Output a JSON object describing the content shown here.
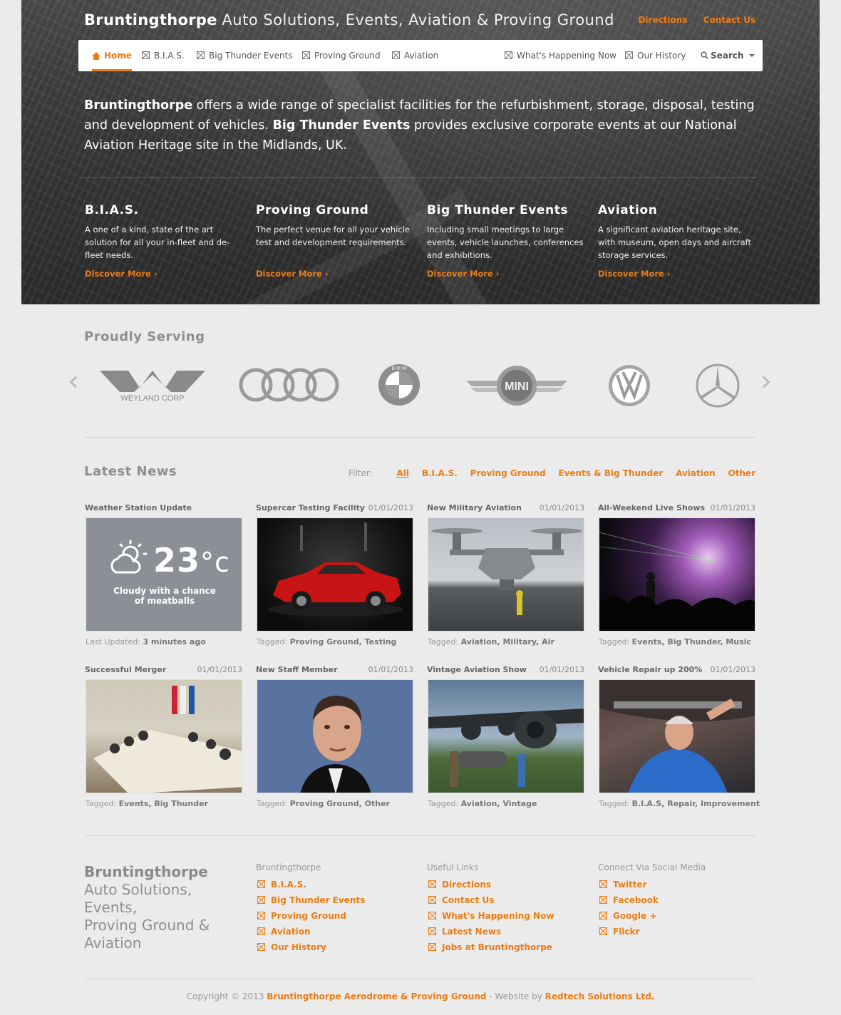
{
  "header": {
    "brand_bold": "Bruntingthorpe",
    "brand_rest": "Auto Solutions, Events, Aviation & Proving Ground",
    "directions": "Directions",
    "contact": "Contact Us"
  },
  "nav": {
    "home": "Home",
    "bias": "B.I.A.S.",
    "big_thunder": "Big Thunder Events",
    "proving": "Proving Ground",
    "aviation": "Aviation",
    "whats_happening": "What's Happening Now",
    "history": "Our History",
    "search": "Search"
  },
  "intro": {
    "b1": "Bruntingthorpe",
    "t1": " offers a wide range of specialist facilities for the refurbishment, storage, disposal, testing and development of vehicles. ",
    "b2": "Big Thunder Events",
    "t2": " provides exclusive corporate events at our National Aviation Heritage site in the Midlands, UK."
  },
  "features": [
    {
      "title": "B.I.A.S.",
      "text": "A one of a kind, state of the art solution for all your in-fleet and de-fleet needs.",
      "link": "Discover More"
    },
    {
      "title": "Proving Ground",
      "text": "The perfect venue for all your vehicle test and development requirements.",
      "link": "Discover More"
    },
    {
      "title": "Big Thunder Events",
      "text": "Including small meetings to large events, vehicle launches, conferences and exhibitions.",
      "link": "Discover More"
    },
    {
      "title": "Aviation",
      "text": "A significant aviation heritage site, with museum, open days and aircraft storage services.",
      "link": "Discover More"
    }
  ],
  "serving": {
    "title": "Proudly Serving",
    "weyland": "WEYLAND CORP",
    "mini": "MINI",
    "bmw": "B M W"
  },
  "news": {
    "title": "Latest News",
    "filter_label": "Filter:",
    "filters": [
      "All",
      "B.I.A.S.",
      "Proving Ground",
      "Events & Big Thunder",
      "Aviation",
      "Other"
    ],
    "tagged_label": "Tagged:",
    "weather": {
      "title": "Weather Station Update",
      "temp": "23",
      "unit": "°c",
      "desc1": "Cloudy with a chance",
      "desc2": "of meatballs",
      "updated_label": "Last Updated:",
      "updated_value": "3 minutes ago"
    },
    "items": [
      {
        "title": "Supercar Testing Facility",
        "date": "01/01/2013",
        "tags": "Proving Ground, Testing"
      },
      {
        "title": "New Military Aviation",
        "date": "01/01/2013",
        "tags": "Aviation, Military, Air"
      },
      {
        "title": "All-Weekend Live Shows",
        "date": "01/01/2013",
        "tags": "Events, Big Thunder, Music"
      },
      {
        "title": "Successful Merger",
        "date": "01/01/2013",
        "tags": "Events, Big Thunder"
      },
      {
        "title": "New Staff Member",
        "date": "01/01/2013",
        "tags": "Proving Ground, Other"
      },
      {
        "title": "Vintage Aviation Show",
        "date": "01/01/2013",
        "tags": "Aviation, Vintage"
      },
      {
        "title": "Vehicle Repair up 200%",
        "date": "01/01/2013",
        "tags": "B.I.A.S, Repair, Improvement"
      }
    ]
  },
  "footer": {
    "brand_bold": "Bruntingthorpe",
    "brand_l1": "Auto Solutions,",
    "brand_l2": "Events,",
    "brand_l3": "Proving Ground &",
    "brand_l4": "Aviation",
    "col1": {
      "title": "Bruntingthorpe",
      "links": [
        "B.I.A.S.",
        "Big Thunder Events",
        "Proving Ground",
        "Aviation",
        "Our History"
      ]
    },
    "col2": {
      "title": "Useful Links",
      "links": [
        "Directions",
        "Contact Us",
        "What's Happening Now",
        "Latest News",
        "Jobs at Bruntingthorpe"
      ]
    },
    "col3": {
      "title": "Connect Via Social Media",
      "links": [
        "Twitter",
        "Facebook",
        "Google +",
        "Flickr"
      ]
    },
    "copy_pre": "Copyright © 2013",
    "copy_org": "Bruntingthorpe Aerodrome & Proving Ground",
    "copy_mid": "- Website by",
    "copy_by": "Redtech Solutions Ltd."
  },
  "colors": {
    "accent": "#ec7d16",
    "page_bg": "#ebebeb",
    "weather_bg": "#8c9096"
  }
}
